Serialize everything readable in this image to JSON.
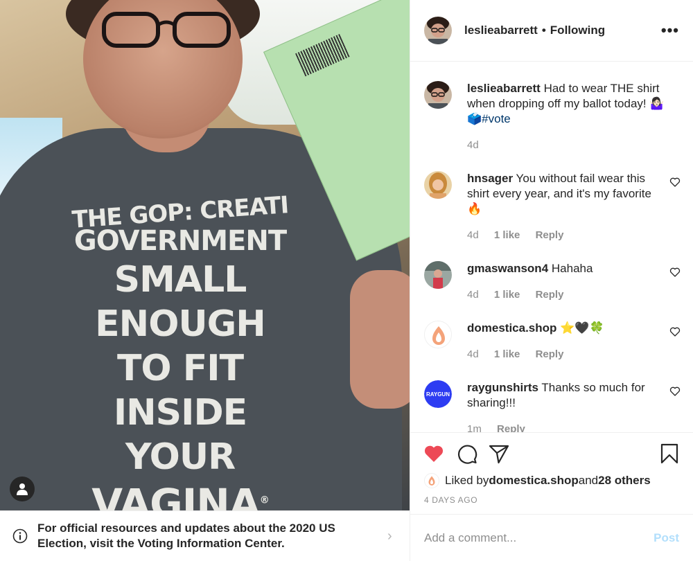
{
  "post": {
    "author": "leslieabarrett",
    "follow_status": "Following",
    "dot": "•",
    "more": "•••",
    "shirt_text": [
      "THE GOP: CREATI",
      "GOVERNMENT",
      "SMALL",
      "ENOUGH",
      "TO FIT",
      "INSIDE",
      "YOUR",
      "VAGINA"
    ],
    "registered_mark": "®"
  },
  "banner": {
    "text": "For official resources and updates about the 2020 US Election, visit the Voting Information Center.",
    "chevron": "›"
  },
  "caption": {
    "username": "leslieabarrett",
    "text": " Had to wear THE shirt when dropping off my ballot today! 🤷🏻‍♀️ ",
    "ballot_emoji": "🗳️",
    "hashtag": "#vote",
    "time": "4d"
  },
  "comments": [
    {
      "username": "hnsager",
      "text": " You without fail wear this shirt every year, and it's my favorite 🔥",
      "time": "4d",
      "likes": "1 like",
      "reply": "Reply"
    },
    {
      "username": "gmaswanson4",
      "text": " Hahaha",
      "time": "4d",
      "likes": "1 like",
      "reply": "Reply"
    },
    {
      "username": "domestica.shop",
      "text": " ⭐️🖤🍀",
      "time": "4d",
      "likes": "1 like",
      "reply": "Reply"
    },
    {
      "username": "raygunshirts",
      "text": " Thanks so much for sharing!!!",
      "time": "1m",
      "likes": "",
      "reply": "Reply",
      "avatar_label": "RAYGUN"
    }
  ],
  "likes": {
    "prefix": "Liked by ",
    "liker": "domestica.shop",
    "middle": " and ",
    "others": "28 others"
  },
  "timestamp": "4 DAYS AGO",
  "add_comment": {
    "placeholder": "Add a comment...",
    "post_label": "Post"
  },
  "colors": {
    "like_red": "#ed4956",
    "post_disabled": "#b2dffc",
    "hashtag": "#00376b",
    "raygun_blue": "#2d3cf2"
  },
  "icons": [
    "info-icon",
    "chevron-right-icon",
    "user-tag-icon",
    "more-icon",
    "heart-icon",
    "comment-icon",
    "share-icon",
    "bookmark-icon"
  ]
}
